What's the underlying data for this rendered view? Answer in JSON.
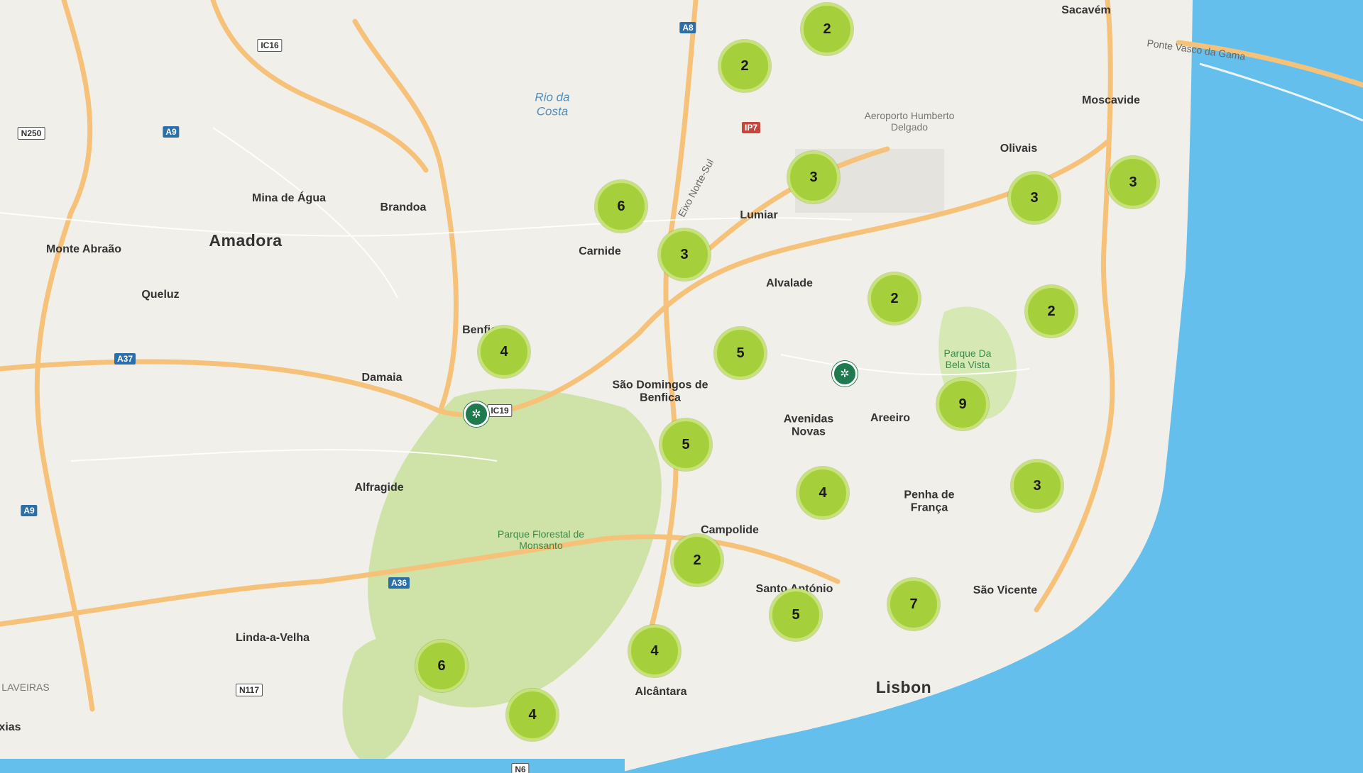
{
  "map": {
    "place_labels": [
      {
        "name": "Sacavém",
        "cls": "med"
      },
      {
        "name": "Moscavide",
        "cls": "med"
      },
      {
        "name": "Olivais",
        "cls": "med"
      },
      {
        "name": "Lumiar",
        "cls": "med"
      },
      {
        "name": "Carnide",
        "cls": "med"
      },
      {
        "name": "Alvalade",
        "cls": "med"
      },
      {
        "name": "Benfica",
        "cls": "med"
      },
      {
        "name": "São Domingos de Benfica",
        "cls": "med"
      },
      {
        "name": "Avenidas Novas",
        "cls": "med"
      },
      {
        "name": "Areeiro",
        "cls": "med"
      },
      {
        "name": "Penha de França",
        "cls": "med"
      },
      {
        "name": "Campolide",
        "cls": "med"
      },
      {
        "name": "Santo António",
        "cls": "med"
      },
      {
        "name": "São Vicente",
        "cls": "med"
      },
      {
        "name": "Lisbon",
        "cls": "big"
      },
      {
        "name": "Alcântara",
        "cls": "med"
      },
      {
        "name": "Amadora",
        "cls": "big"
      },
      {
        "name": "Mina de Água",
        "cls": "med"
      },
      {
        "name": "Brandoa",
        "cls": "med"
      },
      {
        "name": "Monte Abraão",
        "cls": "med"
      },
      {
        "name": "Queluz",
        "cls": "med"
      },
      {
        "name": "Damaia",
        "cls": "med"
      },
      {
        "name": "Alfragide",
        "cls": "med"
      },
      {
        "name": "Linda-a-Velha",
        "cls": "med"
      },
      {
        "name": "Aeroporto Humberto Delgado",
        "cls": "small"
      },
      {
        "name": "Parque Da Bela Vista",
        "cls": "park"
      },
      {
        "name": "Parque Florestal de Monsanto",
        "cls": "park"
      },
      {
        "name": "Rio da Costa",
        "cls": "water"
      },
      {
        "name": "Eixo Norte-Sul",
        "cls": "road"
      },
      {
        "name": "Ponte Vasco da Gama",
        "cls": "road"
      },
      {
        "name": "LAVEIRAS",
        "cls": "small"
      },
      {
        "name": "xias",
        "cls": "med"
      }
    ],
    "road_shields": [
      {
        "label": "A8",
        "style": "blue"
      },
      {
        "label": "IC16",
        "style": "white"
      },
      {
        "label": "A9",
        "style": "blue"
      },
      {
        "label": "N250",
        "style": "white"
      },
      {
        "label": "IP7",
        "style": "red"
      },
      {
        "label": "A37",
        "style": "blue"
      },
      {
        "label": "IC19",
        "style": "white"
      },
      {
        "label": "A9",
        "style": "blue"
      },
      {
        "label": "A36",
        "style": "blue"
      },
      {
        "label": "N117",
        "style": "white"
      },
      {
        "label": "N6",
        "style": "white"
      }
    ],
    "clusters": [
      2,
      2,
      3,
      6,
      3,
      3,
      3,
      2,
      2,
      4,
      5,
      9,
      5,
      3,
      4,
      2,
      5,
      7,
      4,
      6,
      4
    ],
    "location_pins": [
      "location-pin-icon",
      "location-pin-icon"
    ],
    "colors": {
      "water": "#64bfec",
      "park": "#cfe3a8",
      "cluster": "#a6cf3c",
      "road": "#f6c27a",
      "pin": "#1f7a4d"
    }
  }
}
